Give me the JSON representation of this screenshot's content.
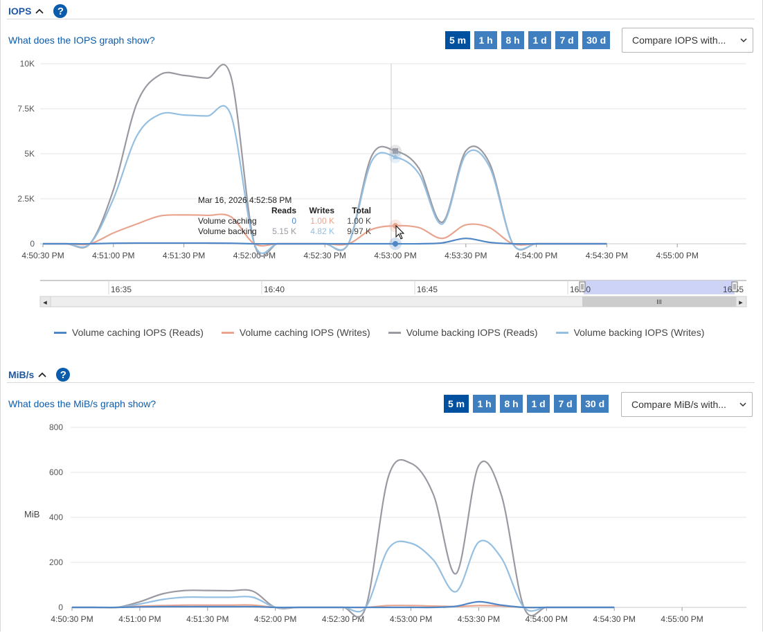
{
  "iops": {
    "title": "IOPS",
    "help_glyph": "?",
    "info_link": "What does the IOPS graph show?",
    "ranges": [
      "5 m",
      "1 h",
      "8 h",
      "1 d",
      "7 d",
      "30 d"
    ],
    "active_range": "5 m",
    "compare_label": "Compare IOPS with...",
    "y_ticks": [
      "10K",
      "7.5K",
      "5K",
      "2.5K",
      "0"
    ],
    "x_ticks": [
      "4:50:30 PM",
      "4:51:00 PM",
      "4:51:30 PM",
      "4:52:00 PM",
      "4:52:30 PM",
      "4:53:00 PM",
      "4:53:30 PM",
      "4:54:00 PM",
      "4:54:30 PM",
      "4:55:00 PM"
    ],
    "tooltip": {
      "time": "Mar 16, 2026 4:52:58 PM",
      "headers": [
        "Reads",
        "Writes",
        "Total"
      ],
      "rows": [
        {
          "label": "Volume caching",
          "reads": "0",
          "writes": "1.00 K",
          "total": "1.00 K"
        },
        {
          "label": "Volume backing",
          "reads": "5.15 K",
          "writes": "4.82 K",
          "total": "9.97 K"
        }
      ]
    }
  },
  "navigator": {
    "ticks": [
      "16:35",
      "16:40",
      "16:45",
      "16:50",
      "16:55"
    ],
    "scroll_grip": "III",
    "left_arrow": "◂",
    "right_arrow": "▸"
  },
  "legend": [
    {
      "label": "Volume caching IOPS (Reads)",
      "color": "#4f86c6"
    },
    {
      "label": "Volume caching IOPS (Writes)",
      "color": "#e8a48e"
    },
    {
      "label": "Volume backing IOPS (Reads)",
      "color": "#9a99a1"
    },
    {
      "label": "Volume backing IOPS (Writes)",
      "color": "#95bfe0"
    }
  ],
  "mibs": {
    "title": "MiB/s",
    "help_glyph": "?",
    "info_link": "What does the MiB/s graph show?",
    "ranges": [
      "5 m",
      "1 h",
      "8 h",
      "1 d",
      "7 d",
      "30 d"
    ],
    "active_range": "5 m",
    "compare_label": "Compare MiB/s with...",
    "y_label": "MiB",
    "y_ticks": [
      "800",
      "600",
      "400",
      "200",
      "0"
    ],
    "x_ticks": [
      "4:50:30 PM",
      "4:51:00 PM",
      "4:51:30 PM",
      "4:52:00 PM",
      "4:52:30 PM",
      "4:53:00 PM",
      "4:53:30 PM",
      "4:54:00 PM",
      "4:54:30 PM",
      "4:55:00 PM"
    ]
  },
  "chart_data": [
    {
      "type": "line",
      "title": "IOPS",
      "ylim": [
        0,
        10000
      ],
      "x": [
        "4:50:30 PM",
        "4:50:40 PM",
        "4:50:50 PM",
        "4:51:00 PM",
        "4:51:10 PM",
        "4:51:20 PM",
        "4:51:30 PM",
        "4:51:40 PM",
        "4:51:50 PM",
        "4:52:00 PM",
        "4:52:10 PM",
        "4:52:20 PM",
        "4:52:30 PM",
        "4:52:40 PM",
        "4:52:50 PM",
        "4:53:00 PM",
        "4:53:10 PM",
        "4:53:20 PM",
        "4:53:30 PM",
        "4:53:40 PM",
        "4:53:50 PM",
        "4:54:00 PM",
        "4:54:30 PM",
        "4:55:00 PM",
        "4:55:30 PM"
      ],
      "series": [
        {
          "name": "Volume caching IOPS (Reads)",
          "color": "#4f86c6",
          "values": [
            0,
            0,
            0,
            30,
            40,
            40,
            40,
            40,
            30,
            0,
            0,
            0,
            0,
            0,
            0,
            0,
            0,
            50,
            300,
            80,
            0,
            0,
            0,
            0,
            0
          ]
        },
        {
          "name": "Volume caching IOPS (Writes)",
          "color": "#e8a48e",
          "values": [
            0,
            0,
            0,
            600,
            1100,
            1550,
            1600,
            1580,
            1500,
            0,
            0,
            0,
            0,
            0,
            800,
            1000,
            900,
            300,
            1050,
            900,
            0,
            0,
            0,
            0,
            0
          ]
        },
        {
          "name": "Volume backing IOPS (Reads)",
          "color": "#9a99a1",
          "values": [
            0,
            0,
            0,
            3000,
            7800,
            9400,
            9350,
            9200,
            9300,
            0,
            0,
            0,
            0,
            0,
            4900,
            5150,
            4200,
            1200,
            5150,
            4500,
            0,
            0,
            0,
            0,
            0
          ]
        },
        {
          "name": "Volume backing IOPS (Writes)",
          "color": "#95bfe0",
          "values": [
            0,
            0,
            0,
            2500,
            6000,
            7200,
            7150,
            7100,
            7150,
            0,
            0,
            0,
            0,
            0,
            4600,
            4820,
            3900,
            1100,
            4950,
            4300,
            0,
            0,
            0,
            0,
            0
          ]
        }
      ]
    },
    {
      "type": "line",
      "title": "MiB/s",
      "ylabel": "MiB",
      "ylim": [
        0,
        800
      ],
      "x": [
        "4:50:30 PM",
        "4:50:40 PM",
        "4:50:50 PM",
        "4:51:00 PM",
        "4:51:10 PM",
        "4:51:20 PM",
        "4:51:30 PM",
        "4:51:40 PM",
        "4:51:50 PM",
        "4:52:00 PM",
        "4:52:10 PM",
        "4:52:20 PM",
        "4:52:30 PM",
        "4:52:40 PM",
        "4:52:50 PM",
        "4:53:00 PM",
        "4:53:10 PM",
        "4:53:20 PM",
        "4:53:30 PM",
        "4:53:40 PM",
        "4:53:50 PM",
        "4:54:00 PM",
        "4:54:30 PM",
        "4:55:00 PM",
        "4:55:30 PM"
      ],
      "series": [
        {
          "name": "Volume caching IOPS (Reads)",
          "color": "#4f86c6",
          "values": [
            0,
            0,
            0,
            2,
            3,
            3,
            3,
            3,
            3,
            0,
            0,
            0,
            0,
            0,
            0,
            0,
            0,
            5,
            25,
            10,
            0,
            0,
            0,
            0,
            0
          ]
        },
        {
          "name": "Volume caching IOPS (Writes)",
          "color": "#e8a48e",
          "values": [
            0,
            0,
            0,
            5,
            8,
            10,
            10,
            10,
            10,
            0,
            0,
            0,
            0,
            0,
            8,
            8,
            6,
            4,
            8,
            6,
            0,
            0,
            0,
            0,
            0
          ]
        },
        {
          "name": "Volume backing IOPS (Reads)",
          "color": "#9a99a1",
          "values": [
            0,
            0,
            0,
            25,
            60,
            75,
            75,
            74,
            72,
            0,
            0,
            0,
            0,
            0,
            580,
            640,
            500,
            150,
            630,
            500,
            0,
            0,
            0,
            0,
            0
          ]
        },
        {
          "name": "Volume backing IOPS (Writes)",
          "color": "#95bfe0",
          "values": [
            0,
            0,
            0,
            15,
            35,
            45,
            45,
            45,
            45,
            0,
            0,
            0,
            0,
            0,
            260,
            285,
            210,
            70,
            290,
            220,
            0,
            0,
            0,
            0,
            0
          ]
        }
      ]
    }
  ]
}
